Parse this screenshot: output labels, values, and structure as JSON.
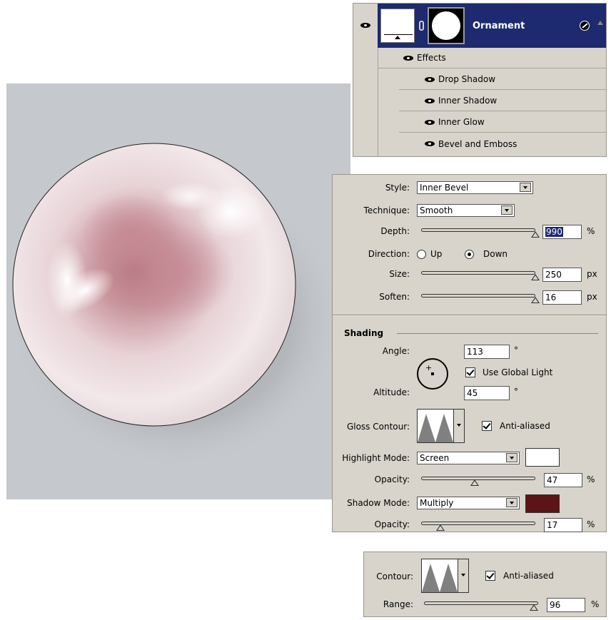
{
  "layers": {
    "layer_name": "Ornament",
    "effects_label": "Effects",
    "effects": [
      "Drop Shadow",
      "Inner Shadow",
      "Inner Glow",
      "Bevel and Emboss"
    ]
  },
  "bevel": {
    "style_label": "Style:",
    "style_value": "Inner Bevel",
    "technique_label": "Technique:",
    "technique_value": "Smooth",
    "depth_label": "Depth:",
    "depth_value": "990",
    "depth_unit": "%",
    "depth_fraction": 1.0,
    "direction_label": "Direction:",
    "direction_up": "Up",
    "direction_down": "Down",
    "direction_selected": "Down",
    "size_label": "Size:",
    "size_value": "250",
    "size_unit": "px",
    "size_fraction": 1.0,
    "soften_label": "Soften:",
    "soften_value": "16",
    "soften_unit": "px",
    "soften_fraction": 1.0
  },
  "shading": {
    "title": "Shading",
    "angle_label": "Angle:",
    "angle_value": "113",
    "angle_unit": "°",
    "use_global_light": "Use Global Light",
    "use_global_light_checked": true,
    "altitude_label": "Altitude:",
    "altitude_value": "45",
    "altitude_unit": "°",
    "gloss_contour_label": "Gloss Contour:",
    "anti_aliased": "Anti-aliased",
    "anti_aliased_checked": true,
    "highlight_mode_label": "Highlight Mode:",
    "highlight_mode_value": "Screen",
    "highlight_color": "#ffffff",
    "highlight_opacity_label": "Opacity:",
    "highlight_opacity_value": "47",
    "highlight_opacity_unit": "%",
    "highlight_opacity_fraction": 0.47,
    "shadow_mode_label": "Shadow Mode:",
    "shadow_mode_value": "Multiply",
    "shadow_color": "#5c1414",
    "shadow_opacity_label": "Opacity:",
    "shadow_opacity_value": "17",
    "shadow_opacity_unit": "%",
    "shadow_opacity_fraction": 0.17
  },
  "contour": {
    "contour_label": "Contour:",
    "anti_aliased": "Anti-aliased",
    "anti_aliased_checked": true,
    "range_label": "Range:",
    "range_value": "96",
    "range_unit": "%",
    "range_fraction": 0.96
  }
}
